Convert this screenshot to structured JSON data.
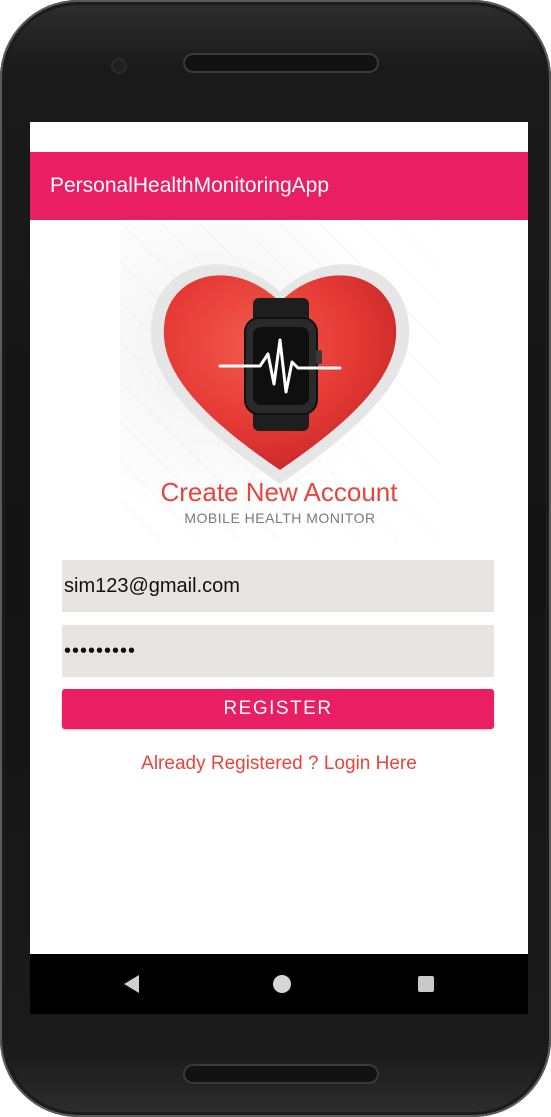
{
  "app": {
    "title": "PersonalHealthMonitoringApp"
  },
  "logo": {
    "caption": "MOBILE HEALTH MONITOR",
    "heart_color": "#e53935",
    "icon": "heart-smartwatch-logo"
  },
  "form": {
    "heading": "Create New Account",
    "email_value": "sim123@gmail.com",
    "password_value": "•••••••••",
    "register_label": "REGISTER",
    "login_link": "Already Registered ? Login Here"
  },
  "navbar": {
    "back_icon": "back-triangle-icon",
    "home_icon": "home-circle-icon",
    "recent_icon": "recent-square-icon"
  },
  "colors": {
    "accent": "#e91e63",
    "text_accent": "#e8453c",
    "input_bg": "#e7e4e1"
  }
}
